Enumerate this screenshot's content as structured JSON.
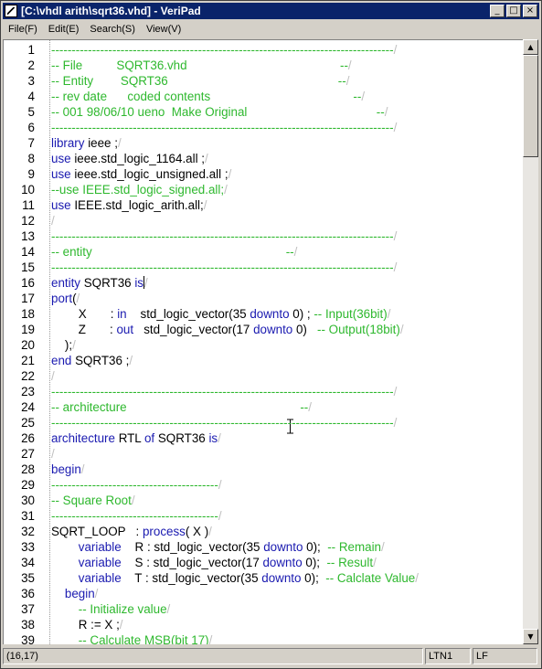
{
  "window": {
    "title": "[C:\\vhdl arith\\sqrt36.vhd] - VeriPad",
    "buttons": {
      "minimize": "_",
      "maximize": "□",
      "close": "×"
    }
  },
  "menu": [
    "File(F)",
    "Edit(E)",
    "Search(S)",
    "View(V)"
  ],
  "colors": {
    "comment": "#2eb82e",
    "keyword": "#1a1ab0",
    "text": "#000000",
    "title_bar": "#0a246a"
  },
  "editor": {
    "lines": [
      {
        "n": "1",
        "segs": [
          {
            "t": "------------------------------------------------------------------------------------",
            "c": "c"
          }
        ]
      },
      {
        "n": "2",
        "segs": [
          {
            "t": "-- File          SQRT36.vhd                                             --",
            "c": "c"
          }
        ]
      },
      {
        "n": "3",
        "segs": [
          {
            "t": "-- Entity        SQRT36                                                  --",
            "c": "c"
          }
        ]
      },
      {
        "n": "4",
        "segs": [
          {
            "t": "-- rev date      coded contents                                          --",
            "c": "c"
          }
        ]
      },
      {
        "n": "5",
        "segs": [
          {
            "t": "-- 001 98/06/10 ueno  Make Original                                      --",
            "c": "c"
          }
        ]
      },
      {
        "n": "6",
        "segs": [
          {
            "t": "------------------------------------------------------------------------------------",
            "c": "c"
          }
        ]
      },
      {
        "n": "7",
        "segs": [
          {
            "t": "library",
            "c": "k"
          },
          {
            "t": " ieee ;",
            "c": "t"
          }
        ]
      },
      {
        "n": "8",
        "segs": [
          {
            "t": "use",
            "c": "k"
          },
          {
            "t": " ieee.std_logic_1164.all ;",
            "c": "t"
          }
        ]
      },
      {
        "n": "9",
        "segs": [
          {
            "t": "use",
            "c": "k"
          },
          {
            "t": " ieee.std_logic_unsigned.all ;",
            "c": "t"
          }
        ]
      },
      {
        "n": "10",
        "segs": [
          {
            "t": "--use IEEE.std_logic_signed.all;",
            "c": "c"
          }
        ]
      },
      {
        "n": "11",
        "segs": [
          {
            "t": "use",
            "c": "k"
          },
          {
            "t": " IEEE.std_logic_arith.all;",
            "c": "t"
          }
        ]
      },
      {
        "n": "12",
        "segs": []
      },
      {
        "n": "13",
        "segs": [
          {
            "t": "------------------------------------------------------------------------------------",
            "c": "c"
          }
        ]
      },
      {
        "n": "14",
        "segs": [
          {
            "t": "-- entity                                                         --",
            "c": "c"
          }
        ]
      },
      {
        "n": "15",
        "segs": [
          {
            "t": "------------------------------------------------------------------------------------",
            "c": "c"
          }
        ]
      },
      {
        "n": "16",
        "segs": [
          {
            "t": "entity",
            "c": "k"
          },
          {
            "t": " SQRT36 ",
            "c": "t"
          },
          {
            "t": "is",
            "c": "k"
          }
        ]
      },
      {
        "n": "17",
        "segs": [
          {
            "t": "port",
            "c": "k"
          },
          {
            "t": "(",
            "c": "t"
          }
        ]
      },
      {
        "n": "18",
        "segs": [
          {
            "t": "        X       : ",
            "c": "t"
          },
          {
            "t": "in",
            "c": "k"
          },
          {
            "t": "    std_logic_vector(35 ",
            "c": "t"
          },
          {
            "t": "downto",
            "c": "k"
          },
          {
            "t": " 0) ; ",
            "c": "t"
          },
          {
            "t": "-- Input(36bit)",
            "c": "c"
          }
        ]
      },
      {
        "n": "19",
        "segs": [
          {
            "t": "        Z       : ",
            "c": "t"
          },
          {
            "t": "out",
            "c": "k"
          },
          {
            "t": "   std_logic_vector(17 ",
            "c": "t"
          },
          {
            "t": "downto",
            "c": "k"
          },
          {
            "t": " 0)   ",
            "c": "t"
          },
          {
            "t": "-- Output(18bit)",
            "c": "c"
          }
        ]
      },
      {
        "n": "20",
        "segs": [
          {
            "t": "    );",
            "c": "t"
          }
        ]
      },
      {
        "n": "21",
        "segs": [
          {
            "t": "end",
            "c": "k"
          },
          {
            "t": " SQRT36 ;",
            "c": "t"
          }
        ]
      },
      {
        "n": "22",
        "segs": []
      },
      {
        "n": "23",
        "segs": [
          {
            "t": "------------------------------------------------------------------------------------",
            "c": "c"
          }
        ]
      },
      {
        "n": "24",
        "segs": [
          {
            "t": "-- architecture                                                   --",
            "c": "c"
          }
        ]
      },
      {
        "n": "25",
        "segs": [
          {
            "t": "------------------------------------------------------------------------------------",
            "c": "c"
          }
        ]
      },
      {
        "n": "26",
        "segs": [
          {
            "t": "architecture",
            "c": "k"
          },
          {
            "t": " RTL ",
            "c": "t"
          },
          {
            "t": "of",
            "c": "k"
          },
          {
            "t": " SQRT36 ",
            "c": "t"
          },
          {
            "t": "is",
            "c": "k"
          }
        ]
      },
      {
        "n": "27",
        "segs": []
      },
      {
        "n": "28",
        "segs": [
          {
            "t": "begin",
            "c": "k"
          }
        ]
      },
      {
        "n": "29",
        "segs": [
          {
            "t": "-----------------------------------------",
            "c": "c"
          }
        ]
      },
      {
        "n": "30",
        "segs": [
          {
            "t": "-- Square Root",
            "c": "c"
          }
        ]
      },
      {
        "n": "31",
        "segs": [
          {
            "t": "-----------------------------------------",
            "c": "c"
          }
        ]
      },
      {
        "n": "32",
        "segs": [
          {
            "t": "SQRT_LOOP   : ",
            "c": "t"
          },
          {
            "t": "process",
            "c": "k"
          },
          {
            "t": "( X )",
            "c": "t"
          }
        ]
      },
      {
        "n": "33",
        "segs": [
          {
            "t": "        ",
            "c": "t"
          },
          {
            "t": "variable",
            "c": "k"
          },
          {
            "t": "    R : std_logic_vector(35 ",
            "c": "t"
          },
          {
            "t": "downto",
            "c": "k"
          },
          {
            "t": " 0);  ",
            "c": "t"
          },
          {
            "t": "-- Remain",
            "c": "c"
          }
        ]
      },
      {
        "n": "34",
        "segs": [
          {
            "t": "        ",
            "c": "t"
          },
          {
            "t": "variable",
            "c": "k"
          },
          {
            "t": "    S : std_logic_vector(17 ",
            "c": "t"
          },
          {
            "t": "downto",
            "c": "k"
          },
          {
            "t": " 0);  ",
            "c": "t"
          },
          {
            "t": "-- Result",
            "c": "c"
          }
        ]
      },
      {
        "n": "35",
        "segs": [
          {
            "t": "        ",
            "c": "t"
          },
          {
            "t": "variable",
            "c": "k"
          },
          {
            "t": "    T : std_logic_vector(35 ",
            "c": "t"
          },
          {
            "t": "downto",
            "c": "k"
          },
          {
            "t": " 0);  ",
            "c": "t"
          },
          {
            "t": "-- Calclate Value",
            "c": "c"
          }
        ]
      },
      {
        "n": "36",
        "segs": [
          {
            "t": "    ",
            "c": "t"
          },
          {
            "t": "begin",
            "c": "k"
          }
        ]
      },
      {
        "n": "37",
        "segs": [
          {
            "t": "        ",
            "c": "t"
          },
          {
            "t": "-- Initialize value",
            "c": "c"
          }
        ]
      },
      {
        "n": "38",
        "segs": [
          {
            "t": "        R := X ;",
            "c": "t"
          }
        ]
      },
      {
        "n": "39",
        "segs": [
          {
            "t": "        ",
            "c": "t"
          },
          {
            "t": "-- Calculate MSB(bit 17)",
            "c": "c"
          }
        ]
      }
    ]
  },
  "status": {
    "position": "(16,17)",
    "mode": "LTN1",
    "eol": "LF"
  }
}
